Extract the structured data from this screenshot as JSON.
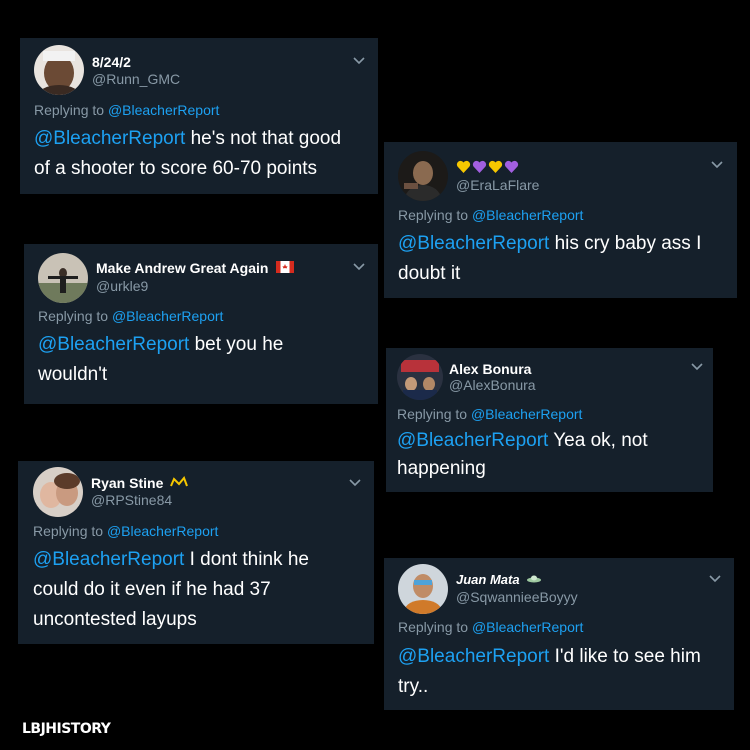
{
  "replying_prefix": "Replying to",
  "tweets": [
    {
      "name": "8/24/2",
      "handle": "@Runn_GMC",
      "reply_to": "@BleacherReport",
      "mention": "@BleacherReport",
      "text_line1": " he's not that good",
      "text_line2": "of a shooter to score 60-70 points"
    },
    {
      "name": "",
      "name_decor": "yellow-purple-hearts",
      "handle": "@EraLaFlare",
      "reply_to": "@BleacherReport",
      "mention": "@BleacherReport",
      "text_line1": " his cry baby ass I",
      "text_line2": "doubt it"
    },
    {
      "name": "Make Andrew Great Again",
      "name_decor": "canada-flag-icon",
      "handle": "@urkle9",
      "reply_to": "@BleacherReport",
      "mention": "@BleacherReport",
      "text_line1": " bet you he",
      "text_line2": "wouldn't"
    },
    {
      "name": "Alex Bonura",
      "handle": "@AlexBonura",
      "reply_to": "@BleacherReport",
      "mention": "@BleacherReport",
      "text_line1": " Yea ok, not",
      "text_line2": "happening"
    },
    {
      "name": "Ryan Stine",
      "name_decor": "crown-icon",
      "handle": "@RPStine84",
      "reply_to": "@BleacherReport",
      "mention": "@BleacherReport",
      "text_line1": " I dont think he",
      "text_line2": "could do it even if he had 37",
      "text_line3": "uncontested layups"
    },
    {
      "name": "Juan Mata",
      "name_decor": "ufo-icon",
      "handle": "@SqwannieeBoyyy",
      "reply_to": "@BleacherReport",
      "mention": "@BleacherReport",
      "text_line1": " I'd like to see him",
      "text_line2": "try.."
    }
  ],
  "watermark": "LBJHISTORY",
  "colors": {
    "background": "#000000",
    "card": "#15202b",
    "mention": "#1da1f2",
    "secondary_text": "#8899a6",
    "primary_text": "#ffffff"
  }
}
